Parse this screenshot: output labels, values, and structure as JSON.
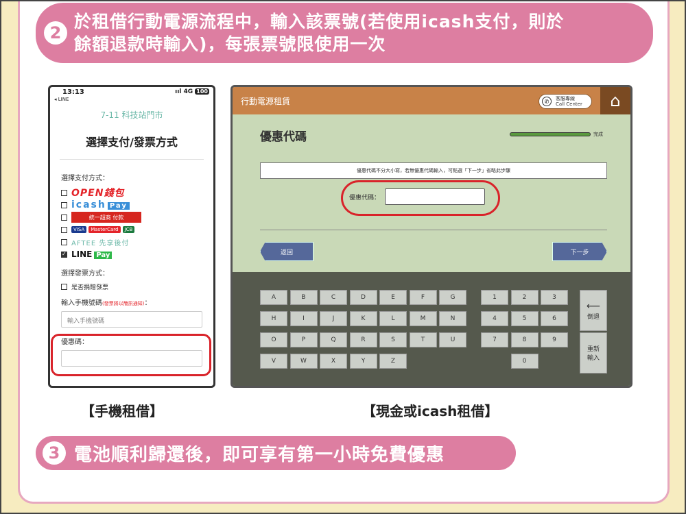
{
  "step2": {
    "number": "2",
    "line1": "於租借行動電源流程中，輸入該票號(若使用icash支付，則於",
    "line2": "餘額退款時輸入)，每張票號限使用一次"
  },
  "phone": {
    "time": "13:13",
    "back_app": "◂ LINE",
    "signal": "ııl 4G",
    "battery": "100",
    "store": "7-11 科技站門市",
    "title": "選擇支付/發票方式",
    "pay_label": "選擇支付方式：",
    "payments": {
      "open": "OPEN錢包",
      "icash": "icash",
      "icash_pay": "Pay",
      "seven_pay": "統一超商 付款",
      "cards": [
        "VISA",
        "MasterCard",
        "JCB"
      ],
      "aftee": "AFTEE 先享後付",
      "line": "LINE",
      "line_pay": "Pay"
    },
    "invoice_label": "選擇發票方式：",
    "donate": "是否捐贈發票",
    "mobile_label": "輸入手機號碼",
    "mobile_note": "(發票將以簡訊通知)",
    "mobile_placeholder": "輸入手機號碼",
    "coupon_label": "優惠碼："
  },
  "kiosk": {
    "title": "行動電源租賃",
    "call_line1": "客服專線",
    "call_line2": "Call Center",
    "home_icon": "home-icon",
    "heading": "優惠代碼",
    "progress_label": "完成",
    "progress": 0.7,
    "note": "優惠代碼不分大小寫，若無優惠代碼輸入，可點選「下一步」省略此步驟",
    "field_label": "優惠代碼：",
    "back": "返回",
    "next": "下一步",
    "letters": [
      [
        "A",
        "B",
        "C",
        "D",
        "E",
        "F",
        "G"
      ],
      [
        "H",
        "I",
        "J",
        "K",
        "L",
        "M",
        "N"
      ],
      [
        "O",
        "P",
        "Q",
        "R",
        "S",
        "T",
        "U"
      ],
      [
        "V",
        "W",
        "X",
        "Y",
        "Z"
      ]
    ],
    "digits": [
      [
        "1",
        "2",
        "3"
      ],
      [
        "4",
        "5",
        "6"
      ],
      [
        "7",
        "8",
        "9"
      ],
      [
        "0"
      ]
    ],
    "backspace_label": "倒退",
    "reenter_label": "重新輸入"
  },
  "captions": {
    "phone": "【手機租借】",
    "kiosk": "【現金或icash租借】"
  },
  "step3": {
    "number": "3",
    "text": "電池順利歸還後，即可享有第一小時免費優惠"
  }
}
